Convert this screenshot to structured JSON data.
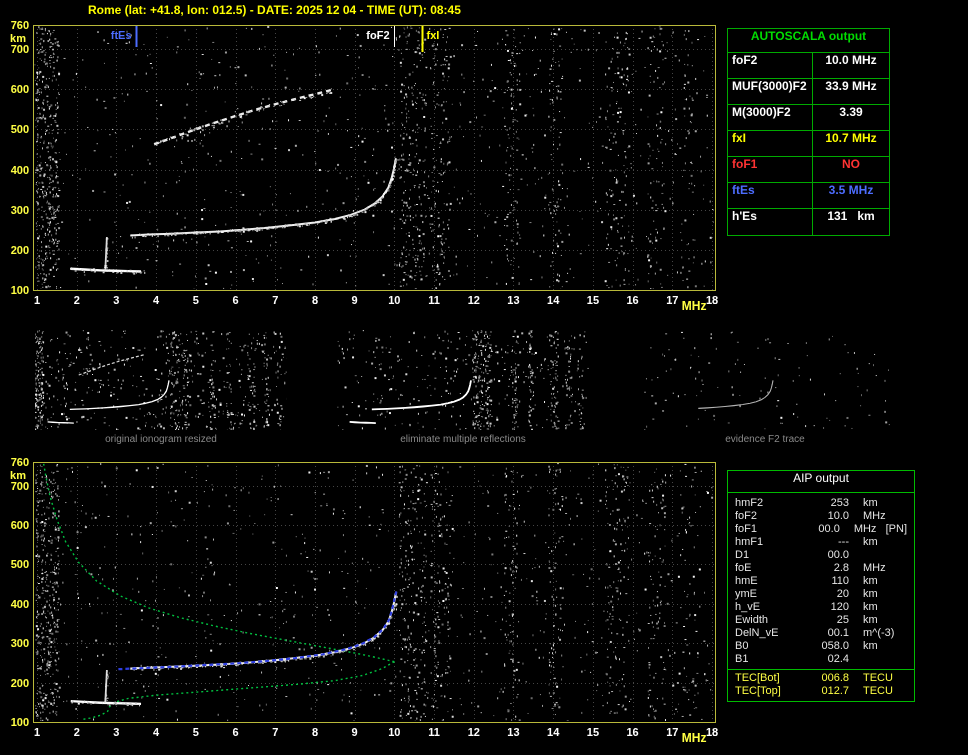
{
  "title": "Rome (lat: +41.8, lon: 012.5) - DATE: 2025 12 04 - TIME (UT): 08:45",
  "colors": {
    "background": "#000000",
    "title": "#ffff00",
    "axis_frame": "#b9b93a",
    "y_tick": "#ffff44",
    "x_tick": "#ffffff",
    "table_green": "#00aa00",
    "profile_green": "#00c040",
    "restored_blue": "#2e3ee0",
    "trace_white": "#ffffff",
    "caption_gray": "#8a8a8a"
  },
  "autoscala_table": {
    "title": "AUTOSCALA output",
    "rows": [
      {
        "param": "foF2",
        "value": "10.0 MHz",
        "color": "#ffffff"
      },
      {
        "param": "MUF(3000)F2",
        "value": "33.9 MHz",
        "color": "#ffffff"
      },
      {
        "param": "M(3000)F2",
        "value": "3.39",
        "color": "#ffffff"
      },
      {
        "param": "fxI",
        "value": "10.7 MHz",
        "color": "#ffff00"
      },
      {
        "param": "foF1",
        "value": "NO",
        "color": "#ff3333"
      },
      {
        "param": "ftEs",
        "value": "3.5 MHz",
        "color": "#4d6dff"
      },
      {
        "param": "h'Es",
        "value": "131   km",
        "color": "#ffffff"
      }
    ]
  },
  "thumbnails": [
    {
      "caption": "original ionogram resized"
    },
    {
      "caption": "eliminate multiple reflections"
    },
    {
      "caption": "evidence F2 trace"
    }
  ],
  "aip_table": {
    "title": "AIP output",
    "rows": [
      {
        "param": "hmF2",
        "value": "253",
        "unit": "km"
      },
      {
        "param": "foF2",
        "value": "10.0",
        "unit": "MHz"
      },
      {
        "param": "foF1",
        "value": "00.0",
        "unit": "MHz   [PN]"
      },
      {
        "param": "hmF1",
        "value": "---",
        "unit": "km"
      },
      {
        "param": "D1",
        "value": "00.0",
        "unit": ""
      },
      {
        "param": "foE",
        "value": "2.8",
        "unit": "MHz"
      },
      {
        "param": "hmE",
        "value": "110",
        "unit": "km"
      },
      {
        "param": "ymE",
        "value": "20",
        "unit": "km"
      },
      {
        "param": "h_vE",
        "value": "120",
        "unit": "km"
      },
      {
        "param": "Ewidth",
        "value": "25",
        "unit": "km"
      },
      {
        "param": "DelN_vE",
        "value": "00.1",
        "unit": "m^(-3)"
      },
      {
        "param": "B0",
        "value": "058.0",
        "unit": "km"
      },
      {
        "param": "B1",
        "value": "02.4",
        "unit": ""
      }
    ],
    "tec_rows": [
      {
        "param": "TEC[Bot]",
        "value": "006.8",
        "unit": "TECU"
      },
      {
        "param": "TEC[Top]",
        "value": "012.7",
        "unit": "TECU"
      }
    ]
  },
  "chart_data": {
    "type": "scatter",
    "title": "Vertical-incidence ionogram, Rome, 2025-12-04 08:45 UT, with AUTOSCALA scaling overlays",
    "xlabel": "MHz",
    "ylabel": "km",
    "x_axis": {
      "min": 1,
      "max": 18,
      "ticks": [
        1,
        2,
        3,
        4,
        5,
        6,
        7,
        8,
        9,
        10,
        11,
        12,
        13,
        14,
        15,
        16,
        17,
        18
      ]
    },
    "y_axis": {
      "min": 100,
      "max": 760,
      "ticks": [
        760,
        700,
        600,
        500,
        400,
        300,
        200,
        100
      ]
    },
    "top_plot": {
      "markers": [
        {
          "label": "ftEs",
          "freq_mhz": 3.5,
          "color": "#4d6dff",
          "line_width": 2,
          "line_len": 22,
          "label_side": "left"
        },
        {
          "label": "foF2",
          "freq_mhz": 10.0,
          "color": "#ffffff",
          "line_width": 1,
          "line_len": 22,
          "label_side": "left"
        },
        {
          "label": "fxI",
          "freq_mhz": 10.7,
          "color": "#ffff00",
          "line_width": 2,
          "line_len": 27,
          "label_side": "right"
        }
      ],
      "traces": {
        "es": [
          [
            1.85,
            153
          ],
          [
            2.2,
            151
          ],
          [
            2.6,
            149
          ],
          [
            2.95,
            148
          ],
          [
            3.3,
            147
          ],
          [
            3.62,
            146
          ]
        ],
        "es_cusp": [
          [
            2.72,
            150
          ],
          [
            2.74,
            190
          ],
          [
            2.76,
            232
          ]
        ],
        "f": [
          [
            3.35,
            236
          ],
          [
            3.8,
            238
          ],
          [
            4.4,
            240
          ],
          [
            5.0,
            243
          ],
          [
            5.6,
            246
          ],
          [
            6.2,
            250
          ],
          [
            6.8,
            255
          ],
          [
            7.4,
            261
          ],
          [
            8.0,
            268
          ],
          [
            8.5,
            277
          ],
          [
            8.9,
            287
          ],
          [
            9.25,
            300
          ],
          [
            9.5,
            315
          ],
          [
            9.7,
            333
          ],
          [
            9.85,
            355
          ],
          [
            9.93,
            378
          ],
          [
            9.99,
            402
          ],
          [
            10.04,
            428
          ]
        ],
        "second_hop": [
          [
            3.95,
            463
          ],
          [
            4.35,
            477
          ],
          [
            4.85,
            495
          ],
          [
            5.4,
            514
          ],
          [
            5.95,
            532
          ],
          [
            6.5,
            549
          ],
          [
            7.05,
            564
          ],
          [
            7.6,
            578
          ],
          [
            8.1,
            590
          ],
          [
            8.45,
            599
          ]
        ]
      }
    },
    "bottom_plot": {
      "profile_topside": [
        [
          10.0,
          253
        ],
        [
          9.75,
          259
        ],
        [
          9.35,
          268
        ],
        [
          8.8,
          279
        ],
        [
          8.1,
          292
        ],
        [
          7.3,
          307
        ],
        [
          6.4,
          324
        ],
        [
          5.5,
          343
        ],
        [
          4.6,
          365
        ],
        [
          3.8,
          390
        ],
        [
          3.1,
          420
        ],
        [
          2.5,
          458
        ],
        [
          2.05,
          505
        ],
        [
          1.72,
          558
        ],
        [
          1.5,
          615
        ],
        [
          1.33,
          672
        ],
        [
          1.22,
          725
        ],
        [
          1.16,
          760
        ]
      ],
      "profile_bottomside": [
        [
          10.0,
          253
        ],
        [
          9.7,
          236
        ],
        [
          9.2,
          218
        ],
        [
          8.5,
          205
        ],
        [
          7.6,
          196
        ],
        [
          6.7,
          189
        ],
        [
          5.8,
          182
        ],
        [
          4.9,
          175
        ],
        [
          4.0,
          168
        ],
        [
          3.3,
          160
        ],
        [
          2.95,
          150
        ],
        [
          2.82,
          138
        ],
        [
          2.78,
          127
        ],
        [
          2.6,
          117
        ],
        [
          2.35,
          110
        ],
        [
          2.1,
          106
        ]
      ],
      "restored_trace": [
        [
          3.05,
          234
        ],
        [
          3.7,
          237
        ],
        [
          4.4,
          240
        ],
        [
          5.1,
          244
        ],
        [
          5.9,
          248
        ],
        [
          6.7,
          254
        ],
        [
          7.5,
          262
        ],
        [
          8.2,
          272
        ],
        [
          8.8,
          285
        ],
        [
          9.2,
          299
        ],
        [
          9.5,
          316
        ],
        [
          9.72,
          336
        ],
        [
          9.87,
          360
        ],
        [
          9.95,
          388
        ],
        [
          10.01,
          415
        ],
        [
          10.05,
          432
        ]
      ]
    },
    "noise": {
      "background_count": 780,
      "rfi_bands": [
        {
          "f": 1.25,
          "w": 0.6,
          "count": 400
        },
        {
          "f": 10.45,
          "w": 0.7,
          "count": 220
        },
        {
          "f": 11.15,
          "w": 0.5,
          "count": 130
        },
        {
          "f": 12.95,
          "w": 0.4,
          "count": 90
        },
        {
          "f": 14.05,
          "w": 0.35,
          "count": 85
        },
        {
          "f": 15.6,
          "w": 0.6,
          "count": 120
        },
        {
          "f": 16.6,
          "w": 0.45,
          "count": 75
        },
        {
          "f": 17.4,
          "w": 0.35,
          "count": 45
        }
      ]
    }
  }
}
